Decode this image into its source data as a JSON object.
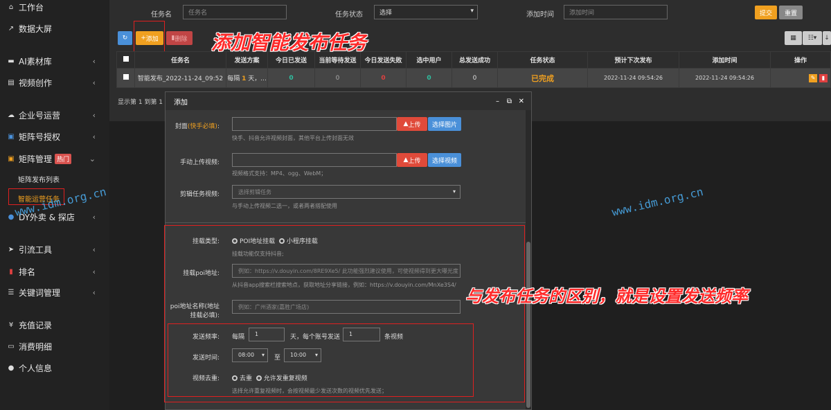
{
  "sidebar": {
    "items": [
      {
        "label": "工作台",
        "icon": "home-icon"
      },
      {
        "label": "数据大屏",
        "icon": "chart-icon"
      },
      {
        "label": "AI素材库",
        "icon": "folder-icon"
      },
      {
        "label": "视频创作",
        "icon": "film-icon"
      },
      {
        "label": "企业号运营",
        "icon": "cloud-icon"
      },
      {
        "label": "矩阵号授权",
        "icon": "grid-icon"
      },
      {
        "label": "矩阵管理",
        "icon": "matrix-icon",
        "badge": "热门"
      },
      {
        "label": "DY外卖 & 探店",
        "icon": "dy-icon"
      },
      {
        "label": "引流工具",
        "icon": "send-icon"
      },
      {
        "label": "排名",
        "icon": "rank-icon"
      },
      {
        "label": "关键词管理",
        "icon": "list-icon"
      },
      {
        "label": "充值记录",
        "icon": "yen-icon"
      },
      {
        "label": "消费明细",
        "icon": "money-icon"
      },
      {
        "label": "个人信息",
        "icon": "user-icon"
      }
    ],
    "sub_items": [
      "矩阵发布列表",
      "智能运营任务"
    ]
  },
  "filters": {
    "task_name_label": "任务名",
    "task_name_placeholder": "任务名",
    "status_label": "任务状态",
    "status_value": "选择",
    "time_label": "添加时间",
    "time_placeholder": "添加时间",
    "submit": "提交",
    "reset": "重置"
  },
  "toolbar": {
    "add": "添加",
    "delete": "删除"
  },
  "table": {
    "headers": [
      "任务名",
      "发送方案",
      "今日已发送",
      "当前等待发送",
      "今日发送失败",
      "选中用户",
      "总发送成功",
      "任务状态",
      "预计下次发布",
      "添加时间",
      "操作"
    ],
    "row": {
      "name": "智能发布_2022-11-24_09:52",
      "plan_prefix": "每隔",
      "plan_num": "1",
      "plan_suffix": "天，...",
      "sent": "0",
      "waiting": "0",
      "failed": "0",
      "users": "0",
      "total": "0",
      "status": "已完成",
      "next": "2022-11-24 09:54:26",
      "added": "2022-11-24 09:54:26"
    },
    "footer": "显示第 1 到第 1 条"
  },
  "modal": {
    "title": "添加",
    "cover_label": "封面",
    "cover_hint": "(快手必填)",
    "upload": "上传",
    "choose_image": "选择图片",
    "cover_help": "快手、抖音允许视频封面，其他平台上传封面无效",
    "manual_label": "手动上传视频:",
    "choose_video": "选择视频",
    "manual_help": "视频格式支持：MP4、ogg、WebM；",
    "clip_label": "剪辑任务视频:",
    "clip_placeholder": "选择剪辑任务",
    "clip_help": "与手动上传视频二选一，或者两者搭配使用",
    "mount_label": "挂载类型:",
    "mount_opt1": "POI地址挂载",
    "mount_opt2": "小程序挂载",
    "mount_help": "挂载功能仅支持抖音;",
    "poi_label": "挂载poi地址:",
    "poi_placeholder": "例如：https://v.douyin.com/8RE9Xe5/ 此功能强烈建议使用，可使视频得到更大曝光度",
    "poi_help": "从抖音app搜索栏搜索地点，获取地址分享链接，例如：https://v.douyin.com/MnXe3S4/",
    "poiname_label_1": "poi地址名称(地址",
    "poiname_label_2": "挂载必填):",
    "poiname_placeholder": "例如：广州酒家(嘉胜广场店)",
    "freq_label": "发送频率:",
    "freq_every": "每隔",
    "freq_days": "1",
    "freq_mid": "天，每个账号发送",
    "freq_count": "1",
    "freq_unit": "条视频",
    "time_label": "发送时间:",
    "time_from": "08:00",
    "time_to_word": "至",
    "time_to": "10:00",
    "dedup_label": "视频去重:",
    "dedup_opt1": "去重",
    "dedup_opt2": "允许发重复视频",
    "dedup_help": "选择允许重复视频时，会按视频最少发送次数的视频优先发送；"
  },
  "annotations": {
    "add_task": "添加智能发布任务",
    "difference": "与发布任务的区别，就是设置发送频率"
  },
  "watermark": "www.idm.org.cn",
  "colors": {
    "orange": "#f0a020",
    "red": "#e04040",
    "blue": "#4a90d9",
    "green": "#2fc0a0"
  }
}
